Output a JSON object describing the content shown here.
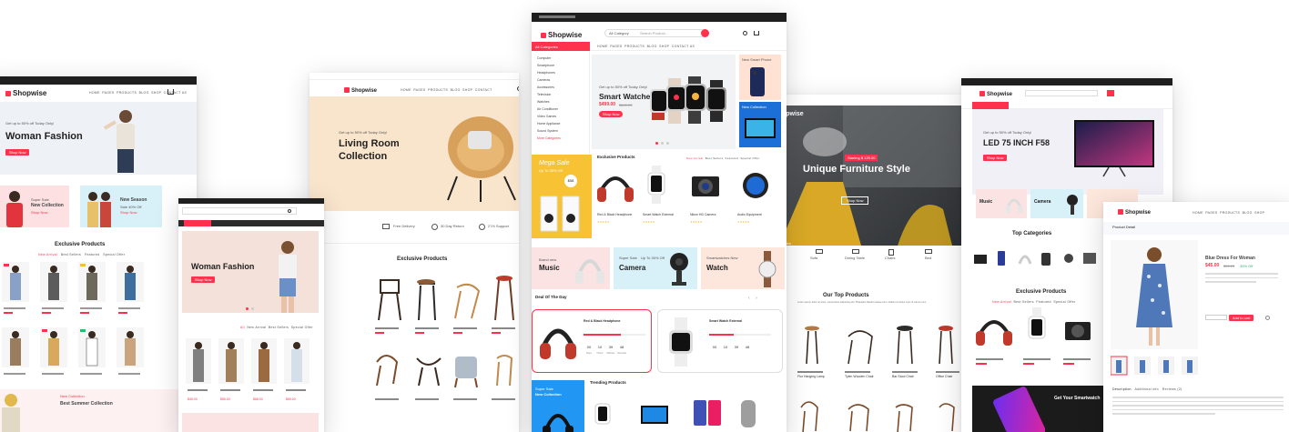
{
  "brand": {
    "name": "Shopwise",
    "accent": "#ff324d",
    "dark": "#1f1f1f"
  },
  "shop_fashion_1": {
    "hero_kicker": "Get up to 50% off Today Only!",
    "hero_title": "Woman Fashion",
    "hero_button": "Shop Now",
    "banner_left_kicker": "Super Sale",
    "banner_left_title": "New Collection",
    "banner_left_link": "Shop Now",
    "banner_right_title": "New Season",
    "banner_right_kicker": "Sale 40% Off",
    "banner_right_link": "Shop Now",
    "section_title": "Exclusive Products",
    "tabs": [
      "New Arrival",
      "Best Sellers",
      "Featured",
      "Special Offer"
    ],
    "promo_kicker": "New Collection",
    "promo_title": "Best Summer Collection"
  },
  "shop_fashion_2": {
    "hero_title": "Woman Fashion",
    "hero_button": "Shop Now",
    "tabs": [
      "All",
      "New Arrival",
      "Best Sellers",
      "Special Offer"
    ],
    "prices": [
      "$45.00",
      "$55.00",
      "$68.00",
      "$69.00"
    ]
  },
  "shop_furniture_1": {
    "hero_kicker": "Get up to 50% off Today Only!",
    "hero_title_1": "Living Room",
    "hero_title_2": "Collection",
    "features": [
      "Free Delivery",
      "30 Day Return",
      "27/4 Support"
    ],
    "section_title": "Exclusive Products",
    "prices": [
      "$45.00",
      "$55.00",
      "$68.00",
      "$69.00"
    ]
  },
  "shop_electronics_1": {
    "search_placeholder": "Search Product...",
    "category_label": "All Category",
    "category_menu_label": "All Categories",
    "categories": [
      "Computer",
      "Smartphone",
      "Headphones",
      "Cameras",
      "Accessories",
      "Television",
      "Watches",
      "Air Conditioner",
      "Video Games",
      "Home Appliance",
      "Sound System",
      "More Categories"
    ],
    "hero_kicker": "Get up to 50% off Today Only!",
    "hero_title": "Smart Watches",
    "hero_price": "$499.00",
    "hero_old_price": "$849.00",
    "hero_button": "Shop Now",
    "side_banner_1": "New Smart Phone",
    "side_banner_2": "New Collection",
    "sale_banner_title": "Mega Sale",
    "sale_banner_text": "Up To 35% Off",
    "sale_banner_badge": "$58",
    "section_title": "Exclusive Products",
    "tabs": [
      "New Arrival",
      "Best Sellers",
      "Featured",
      "Special Offer"
    ],
    "products": [
      "Red & Black Headphone",
      "Smart Watch External",
      "Nikon HD Camera",
      "Audio Equipment"
    ],
    "banner_music_kicker": "Brand new",
    "banner_music": "Music",
    "banner_camera_kicker": "Super Sale",
    "banner_camera_sub": "Up To 30% Off",
    "banner_camera": "Camera",
    "banner_watch_kicker": "Smartwatches New",
    "banner_watch": "Watch",
    "deal_title": "Deal Of The Day",
    "deal_1_name": "Red & Black Headphone",
    "deal_2_name": "Smart Watch External",
    "countdown": [
      "00",
      "10",
      "39",
      "48"
    ],
    "countdown_labels": [
      "Days",
      "Hours",
      "Minutes",
      "Seconds"
    ],
    "trending_title": "Trending Products",
    "trending_banner_kicker": "Super Sale",
    "trending_banner_title": "New Collection"
  },
  "shop_furniture_2": {
    "brand": "Shopwise",
    "hero_badge": "Starting $ 129.00",
    "hero_title": "Unique Furniture Style",
    "hero_button": "Shop Now",
    "categories_label": "Top Categories",
    "category_items": [
      "Sofa",
      "Dining Table",
      "Chairs",
      "Bed"
    ],
    "section_title": "Our Top Products",
    "section_sub": "Lorem ipsum dolor sit amet, consectetur adipiscing elit. Phasellus blandit massa enim. Nullam id varius nunc id varius nunc.",
    "products": [
      "Flor Hanging Lamp",
      "Tylen Wooden Chair",
      "Bar Stool Chair",
      "Office Chair"
    ]
  },
  "shop_electronics_2": {
    "hero_kicker": "Get up to 50% off Today Only!",
    "hero_title": "LED 75 INCH F58",
    "hero_button": "Shop Now",
    "banner_music": "Music",
    "banner_camera": "Camera",
    "categories_title": "Top Categories",
    "section_title": "Exclusive Products",
    "tabs": [
      "New Arrival",
      "Best Sellers",
      "Featured",
      "Special Offer"
    ],
    "promo_title": "Get Your Smartwatch"
  },
  "product_detail": {
    "brand": "Shopwise",
    "page_title": "Product Detail",
    "product_name": "Blue Dress For Woman",
    "price": "$45.00",
    "old_price": "$55.25",
    "discount": "35% Off",
    "add_to_cart": "Add to cart",
    "tabs": [
      "Description",
      "Additional info",
      "Reviews (2)"
    ]
  }
}
